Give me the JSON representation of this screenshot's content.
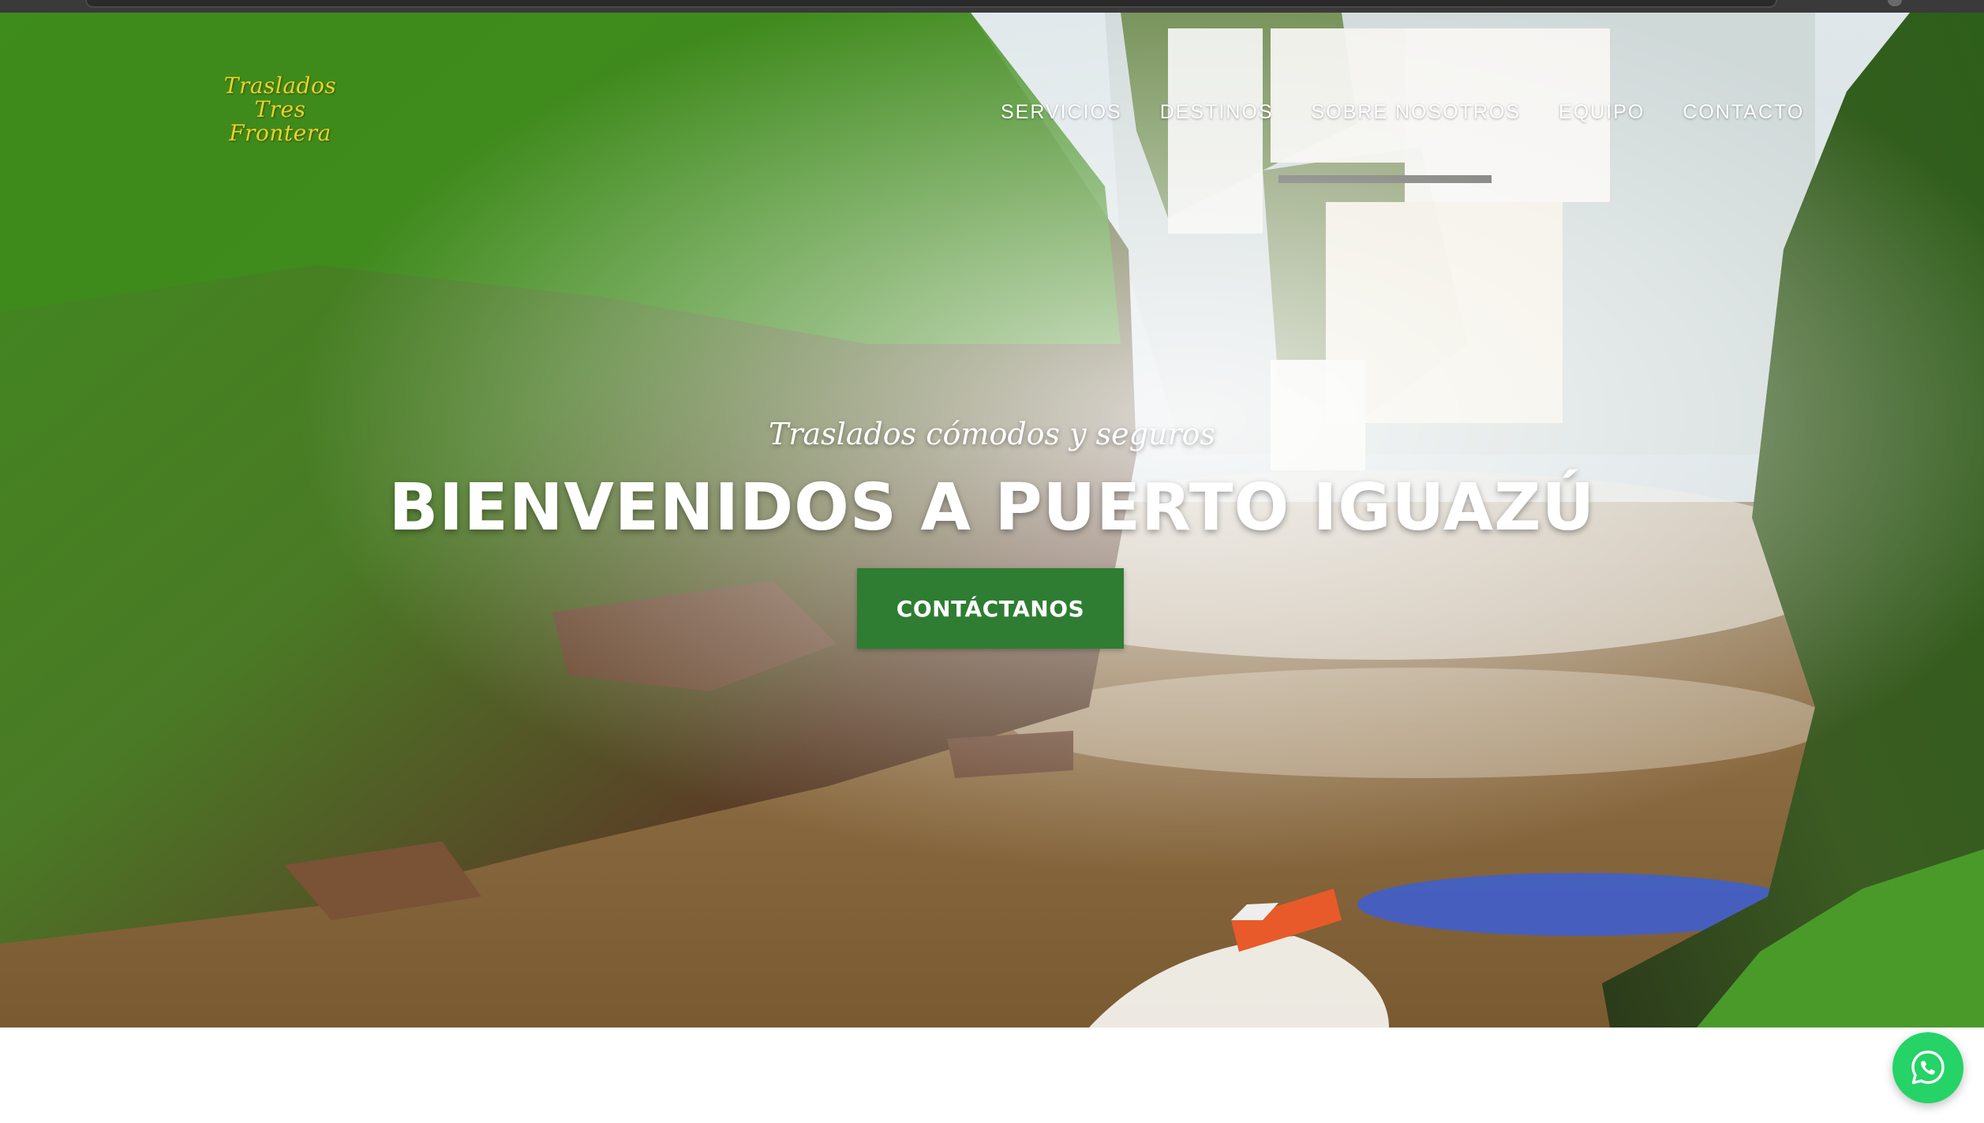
{
  "brand": {
    "logo_line1": "Traslados",
    "logo_line2": "Tres Frontera",
    "logo_color": "#f2d024"
  },
  "nav": {
    "items": [
      {
        "label": "SERVICIOS"
      },
      {
        "label": "DESTINOS"
      },
      {
        "label": "SOBRE NOSOTROS"
      },
      {
        "label": "EQUIPO"
      },
      {
        "label": "CONTACTO"
      }
    ]
  },
  "hero": {
    "tagline": "Traslados cómodos y seguros",
    "headline": "BIENVENIDOS A PUERTO IGUAZÚ",
    "cta_label": "CONTÁCTANOS",
    "cta_color": "#2e7d32",
    "background": "iguazu-falls-photo"
  },
  "floating": {
    "whatsapp_icon": "whatsapp-icon",
    "whatsapp_color": "#25d366"
  }
}
